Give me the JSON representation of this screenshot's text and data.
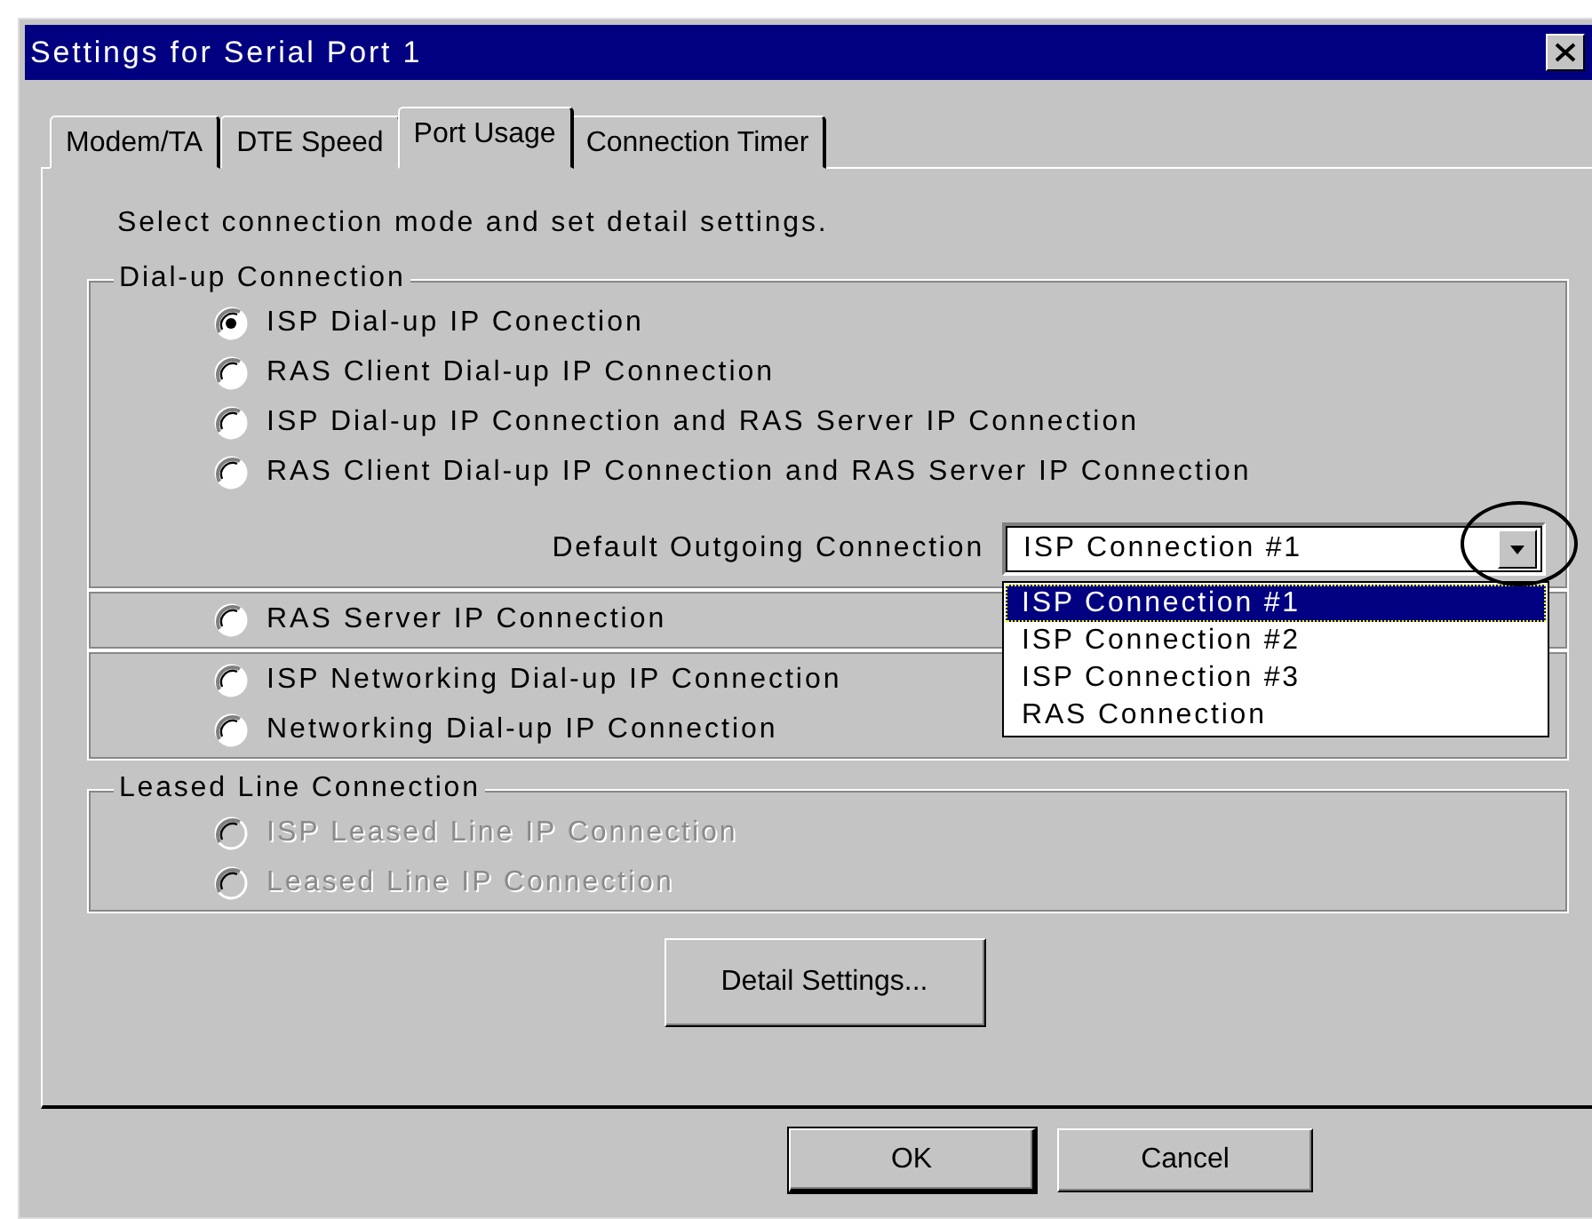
{
  "window": {
    "title": "Settings for Serial Port 1"
  },
  "tabs": [
    {
      "label": "Modem/TA",
      "selected": false
    },
    {
      "label": "DTE Speed",
      "selected": false
    },
    {
      "label": "Port Usage",
      "selected": true
    },
    {
      "label": "Connection Timer",
      "selected": false
    }
  ],
  "instruction": "Select connection mode and set detail settings.",
  "groups": [
    {
      "legend": "Dial-up Connection",
      "options": [
        {
          "label": "ISP Dial-up IP Conection",
          "selected": true,
          "disabled": false
        },
        {
          "label": "RAS Client Dial-up IP Connection",
          "selected": false,
          "disabled": false
        },
        {
          "label": "ISP Dial-up IP Connection and RAS Server IP Connection",
          "selected": false,
          "disabled": false
        },
        {
          "label": "RAS Client Dial-up IP Connection and RAS Server IP Connection",
          "selected": false,
          "disabled": false
        }
      ],
      "dropdown": {
        "label": "Default Outgoing Connection",
        "value": "ISP Connection #1",
        "expanded": true,
        "highlighted": true,
        "options": [
          {
            "label": "ISP Connection #1",
            "selected": true
          },
          {
            "label": "ISP Connection #2",
            "selected": false
          },
          {
            "label": "ISP Connection #3",
            "selected": false
          },
          {
            "label": "RAS Connection",
            "selected": false
          }
        ]
      }
    },
    {
      "options": [
        {
          "label": "RAS Server IP Connection",
          "selected": false,
          "disabled": false
        }
      ]
    },
    {
      "options": [
        {
          "label": "ISP Networking Dial-up IP Connection",
          "selected": false,
          "disabled": false
        },
        {
          "label": "Networking Dial-up IP Connection",
          "selected": false,
          "disabled": false
        }
      ]
    },
    {
      "legend": "Leased Line Connection",
      "options": [
        {
          "label": "ISP Leased Line IP Connection",
          "selected": false,
          "disabled": true
        },
        {
          "label": "Leased Line IP Connection",
          "selected": false,
          "disabled": true
        }
      ]
    }
  ],
  "buttons": [
    {
      "label": "Detail Settings...",
      "kind": "panel",
      "default": false
    },
    {
      "label": "OK",
      "kind": "footer",
      "default": true
    },
    {
      "label": "Cancel",
      "kind": "footer",
      "default": false
    }
  ]
}
